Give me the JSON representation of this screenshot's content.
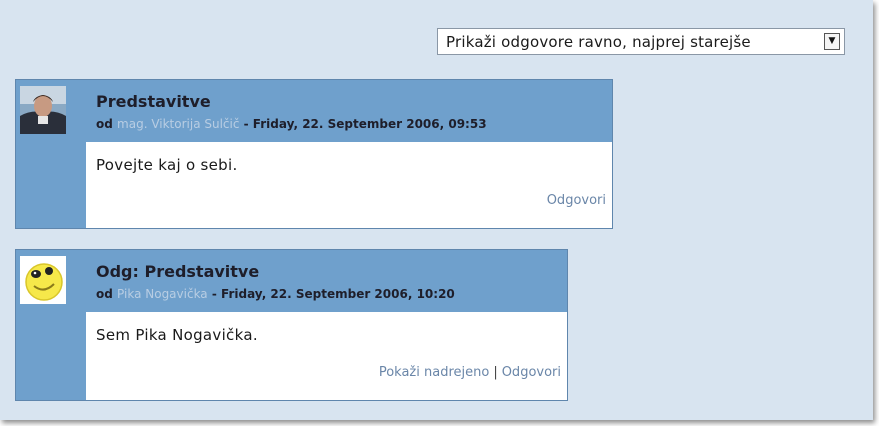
{
  "display_mode": {
    "selected": "Prikaži odgovore ravno, najprej starejše"
  },
  "posts": [
    {
      "title": "Predstavitve",
      "by_prefix": "od",
      "author": "mag. Viktorija Sulčič",
      "date": "- Friday, 22. September 2006, 09:53",
      "message": "Povejte kaj o sebi.",
      "reply_link": "Odgovori",
      "avatar_icon": "user-photo-icon"
    },
    {
      "title": "Odg: Predstavitve",
      "by_prefix": "od",
      "author": "Pika Nogavička",
      "date": "- Friday, 22. September 2006, 10:20",
      "message": "Sem Pika Nogavička.",
      "parent_link": "Pokaži nadrejeno",
      "separator": "|",
      "reply_link": "Odgovori",
      "avatar_icon": "smiley-face-icon"
    }
  ],
  "colors": {
    "page_background": "#d8e4f0",
    "post_header": "#6fa0cc",
    "post_body": "#ffffff",
    "link": "#6a86a8"
  }
}
